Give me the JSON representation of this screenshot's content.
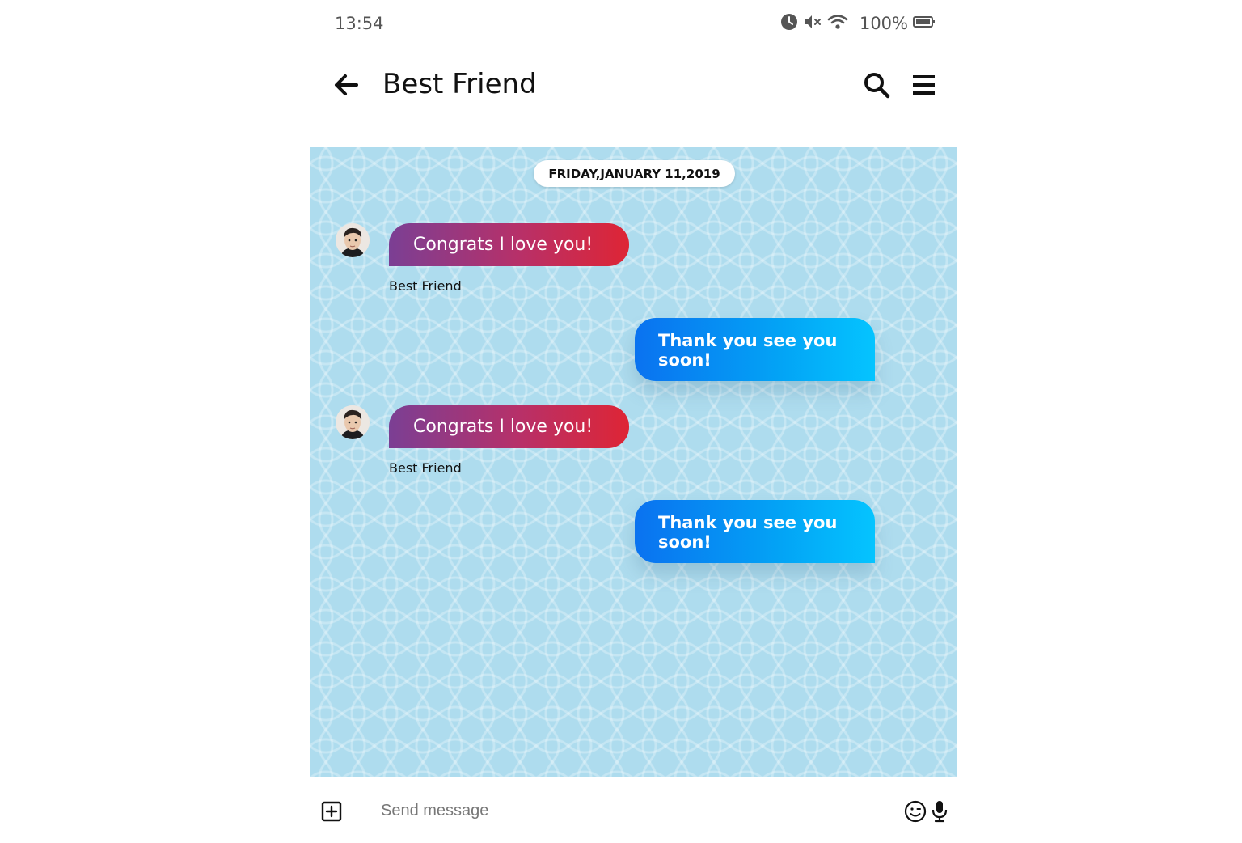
{
  "status_bar": {
    "time": "13:54",
    "battery_percent": "100%",
    "icons": [
      "alarm-icon",
      "mute-icon",
      "wifi-icon",
      "battery-icon"
    ]
  },
  "header": {
    "title": "Best Friend",
    "icons": [
      "back-arrow-icon",
      "search-icon",
      "menu-icon"
    ]
  },
  "chat": {
    "date": "FRIDAY,JANUARY 11,2019",
    "messages": [
      {
        "direction": "incoming",
        "text": "Congrats I love you!",
        "sender": "Best Friend"
      },
      {
        "direction": "outgoing",
        "text": "Thank you see you soon!"
      },
      {
        "direction": "incoming",
        "text": "Congrats I love you!",
        "sender": "Best Friend"
      },
      {
        "direction": "outgoing",
        "text": "Thank you see you soon!"
      }
    ]
  },
  "composer": {
    "placeholder": "Send message",
    "icons": [
      "add-attachment-icon",
      "emoji-icon",
      "microphone-icon"
    ]
  },
  "colors": {
    "chat_background": "#aedcee",
    "incoming_gradient": [
      "#7b3f94",
      "#de2535"
    ],
    "outgoing_gradient": [
      "#0a72f0",
      "#05c4ff"
    ]
  }
}
